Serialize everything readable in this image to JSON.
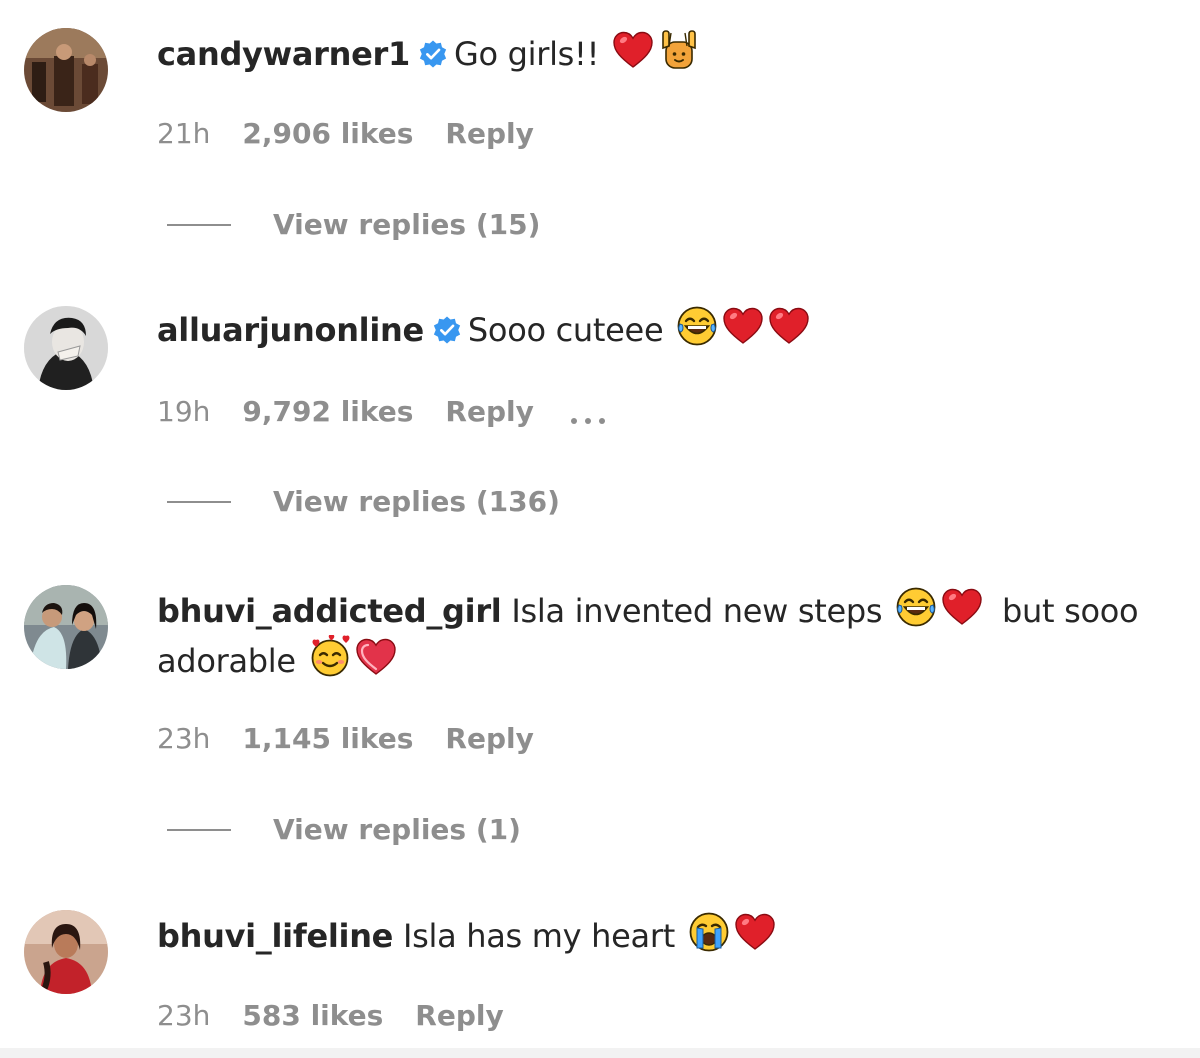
{
  "comments": [
    {
      "username": "candywarner1",
      "verified": true,
      "text": "Go girls!!",
      "emojis": [
        "red-heart-icon",
        "person-raising-hands-icon"
      ],
      "time": "21h",
      "likes": "2,906 likes",
      "reply_label": "Reply",
      "view_replies": "View replies (15)"
    },
    {
      "username": "alluarjunonline",
      "verified": true,
      "text": "Sooo cuteee",
      "emojis": [
        "face-with-tears-of-joy-icon",
        "red-heart-icon",
        "red-heart-icon"
      ],
      "time": "19h",
      "likes": "9,792 likes",
      "reply_label": "Reply",
      "more_icon": "more-options-icon",
      "view_replies": "View replies (136)"
    },
    {
      "username": "bhuvi_addicted_girl",
      "verified": false,
      "text_part1": "Isla invented new steps",
      "text_part2": "but sooo adorable",
      "emojis": [
        "face-with-tears-of-joy-icon",
        "red-heart-icon",
        "smiling-face-with-hearts-icon",
        "heart-icon"
      ],
      "time": "23h",
      "likes": "1,145 likes",
      "reply_label": "Reply",
      "view_replies": "View replies (1)"
    },
    {
      "username": "bhuvi_lifeline",
      "verified": false,
      "text": "Isla has my heart",
      "emojis": [
        "loudly-crying-face-icon",
        "red-heart-icon"
      ],
      "time": "23h",
      "likes": "583 likes",
      "reply_label": "Reply"
    }
  ],
  "colors": {
    "text": "#262626",
    "secondary": "#8e8e8e",
    "verified_blue": "#3897f0",
    "heart_red": "#e0202a"
  }
}
